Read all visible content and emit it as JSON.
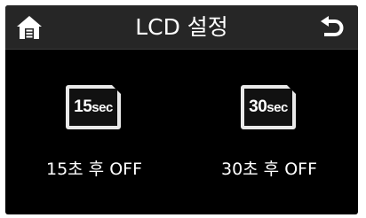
{
  "header": {
    "title": "LCD 설정",
    "home_icon": "home-icon",
    "back_icon": "back-arrow-icon"
  },
  "options": [
    {
      "icon_number": "15",
      "icon_unit": "sec",
      "label": "15초 후 OFF"
    },
    {
      "icon_number": "30",
      "icon_unit": "sec",
      "label": "30초 후 OFF"
    }
  ],
  "colors": {
    "background": "#000000",
    "header": "#262626",
    "text": "#ffffff",
    "icon_border": "#e9e9e9"
  }
}
